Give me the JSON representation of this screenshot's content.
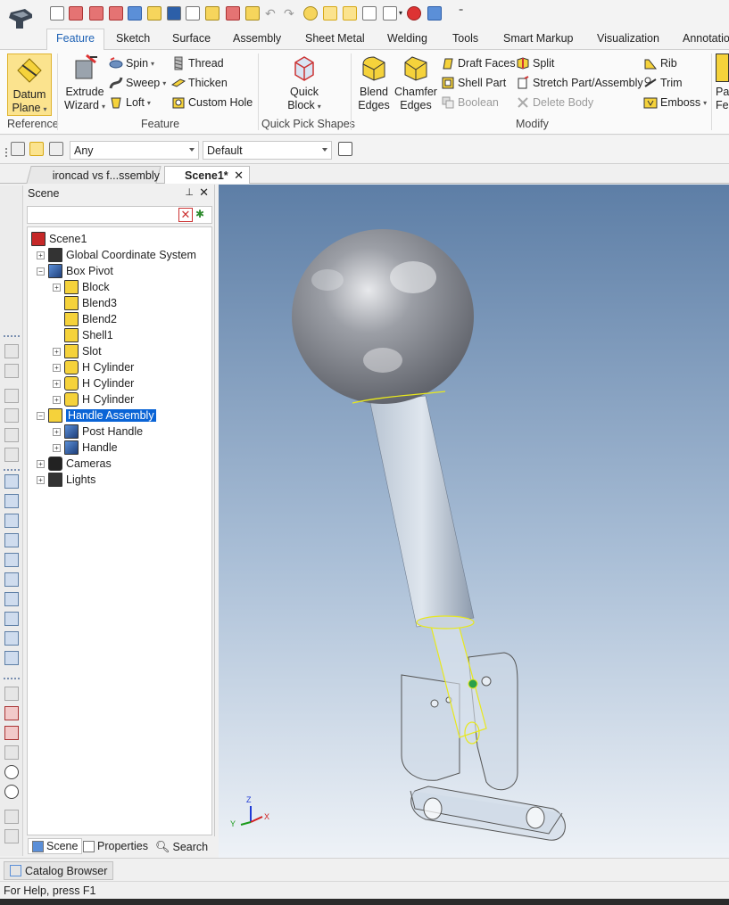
{
  "ribbon": {
    "tabs": [
      "Feature",
      "Sketch",
      "Surface",
      "Assembly",
      "Sheet Metal",
      "Welding",
      "Tools",
      "Smart Markup",
      "Visualization",
      "Annotatio"
    ],
    "active_tab": "Feature",
    "groups": {
      "reference": {
        "label": "Reference",
        "datum_plane": {
          "line1": "Datum",
          "line2": "Plane"
        }
      },
      "feature": {
        "label": "Feature",
        "extrude_wizard": {
          "line1": "Extrude",
          "line2": "Wizard"
        },
        "spin": "Spin",
        "sweep": "Sweep",
        "loft": "Loft",
        "thread": "Thread",
        "thicken": "Thicken",
        "custom_hole": "Custom Hole"
      },
      "quick_pick": {
        "label": "Quick Pick Shapes",
        "quick_block": {
          "line1": "Quick",
          "line2": "Block"
        }
      },
      "modify": {
        "label": "Modify",
        "blend_edges": {
          "line1": "Blend",
          "line2": "Edges"
        },
        "chamfer_edges": {
          "line1": "Chamfer",
          "line2": "Edges"
        },
        "draft_faces": "Draft Faces",
        "shell_part": "Shell Part",
        "boolean": "Boolean",
        "split": "Split",
        "stretch": "Stretch Part/Assembly",
        "delete_body": "Delete Body",
        "rib": "Rib",
        "trim": "Trim",
        "emboss": "Emboss"
      },
      "overflow": {
        "line1": "Pa",
        "line2": "Fe"
      }
    }
  },
  "toolbar": {
    "filter_value": "Any",
    "style_value": "Default"
  },
  "doc_tabs": [
    {
      "label": "ironcad vs f...ssembly",
      "active": false
    },
    {
      "label": "Scene1*",
      "active": true
    }
  ],
  "scene_panel": {
    "title": "Scene",
    "tree": [
      {
        "label": "Scene1",
        "indent": 0,
        "expander": "",
        "icon": "scene"
      },
      {
        "label": "Global Coordinate System",
        "indent": 1,
        "expander": "+",
        "icon": "axes"
      },
      {
        "label": "Box Pivot",
        "indent": 1,
        "expander": "-",
        "icon": "part"
      },
      {
        "label": "Block",
        "indent": 2,
        "expander": "+",
        "icon": "block"
      },
      {
        "label": "Blend3",
        "indent": 2,
        "expander": "",
        "icon": "blend"
      },
      {
        "label": "Blend2",
        "indent": 2,
        "expander": "",
        "icon": "blend"
      },
      {
        "label": "Shell1",
        "indent": 2,
        "expander": "",
        "icon": "shell"
      },
      {
        "label": "Slot",
        "indent": 2,
        "expander": "+",
        "icon": "block"
      },
      {
        "label": "H Cylinder",
        "indent": 2,
        "expander": "+",
        "icon": "cyl"
      },
      {
        "label": "H Cylinder",
        "indent": 2,
        "expander": "+",
        "icon": "cyl"
      },
      {
        "label": "H Cylinder",
        "indent": 2,
        "expander": "+",
        "icon": "cyl"
      },
      {
        "label": "Handle Assembly",
        "indent": 1,
        "expander": "-",
        "icon": "assembly",
        "selected": true
      },
      {
        "label": "Post Handle",
        "indent": 2,
        "expander": "+",
        "icon": "part"
      },
      {
        "label": "Handle",
        "indent": 2,
        "expander": "+",
        "icon": "part"
      },
      {
        "label": "Cameras",
        "indent": 1,
        "expander": "+",
        "icon": "camera"
      },
      {
        "label": "Lights",
        "indent": 1,
        "expander": "+",
        "icon": "light"
      }
    ],
    "bottom_tabs": [
      "Scene",
      "Properties",
      "Search"
    ]
  },
  "viewport": {
    "axis_labels": {
      "z": "Z",
      "y": "Y",
      "x": "X"
    }
  },
  "catalog_browser": "Catalog Browser",
  "status": "For Help, press F1",
  "colors": {
    "accent": "#1e62b5",
    "selection": "#0a64d6",
    "viewport_top": "#5d7ea6",
    "viewport_bottom": "#eef2f7"
  }
}
